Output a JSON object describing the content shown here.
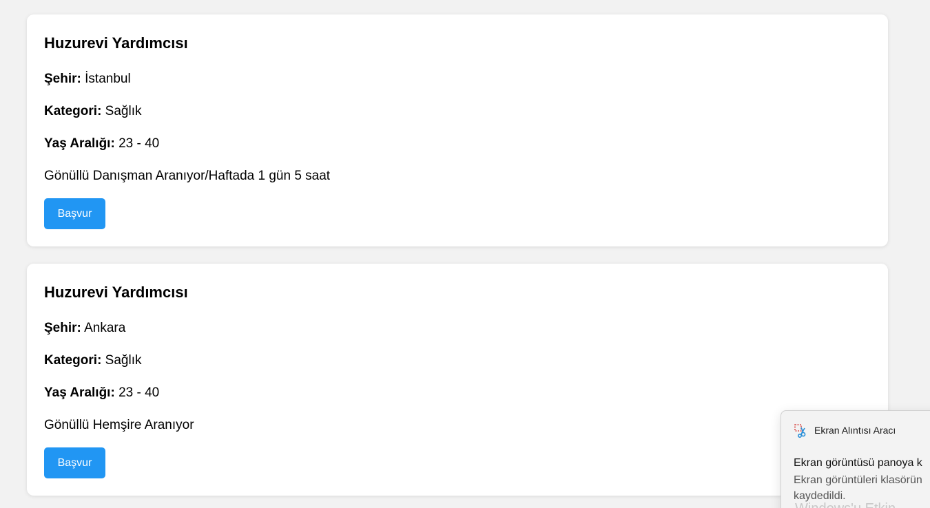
{
  "listings": [
    {
      "title": "Huzurevi Yardımcısı",
      "city_label": "Şehir:",
      "city": " İstanbul",
      "category_label": "Kategori:",
      "category": " Sağlık",
      "age_label": "Yaş Aralığı:",
      "age": " 23 - 40",
      "description": "Gönüllü Danışman Aranıyor/Haftada 1 gün 5 saat",
      "apply_label": "Başvur"
    },
    {
      "title": "Huzurevi Yardımcısı",
      "city_label": "Şehir:",
      "city": " Ankara",
      "category_label": "Kategori:",
      "category": " Sağlık",
      "age_label": "Yaş Aralığı:",
      "age": " 23 - 40",
      "description": "Gönüllü Hemşire Aranıyor",
      "apply_label": "Başvur"
    }
  ],
  "toast": {
    "app_name": "Ekran Alıntısı Aracı",
    "icon": "snipping-tool-icon",
    "title": "Ekran görüntüsü panoya k",
    "body_line1": "Ekran görüntüleri klasörün",
    "body_line2": "kaydedildi.",
    "ghost_text": "Windows'u Etkin"
  },
  "colors": {
    "background": "#f2f2f2",
    "card": "#ffffff",
    "button": "#2196f3",
    "button_text": "#ffffff"
  }
}
